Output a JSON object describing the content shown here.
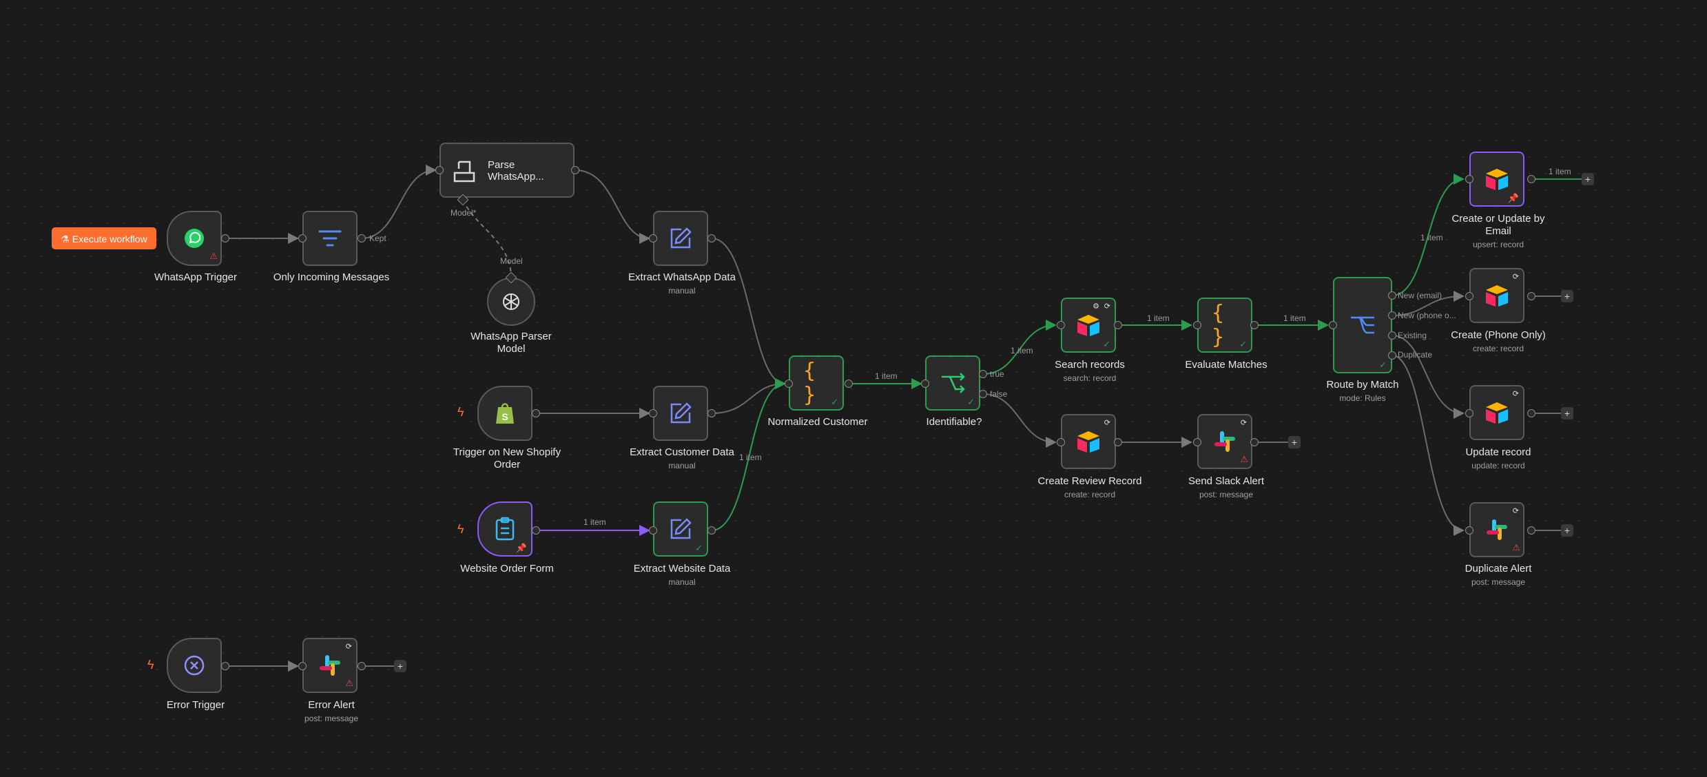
{
  "toolbar": {
    "execute_label": "Execute workflow"
  },
  "nodes": {
    "whatsapp_trigger": {
      "name": "WhatsApp Trigger"
    },
    "only_incoming": {
      "name": "Only Incoming Messages",
      "output_label": "Kept"
    },
    "parse_whatsapp": {
      "name_line1": "Parse",
      "name_line2": "WhatsApp...",
      "model_port": "Model*"
    },
    "parser_model": {
      "name_line1": "WhatsApp Parser",
      "name_line2": "Model",
      "port_label": "Model"
    },
    "extract_whatsapp": {
      "name": "Extract WhatsApp Data",
      "sub": "manual"
    },
    "shopify_trigger": {
      "name_line1": "Trigger on New Shopify",
      "name_line2": "Order"
    },
    "extract_customer": {
      "name": "Extract Customer Data",
      "sub": "manual"
    },
    "website_form": {
      "name": "Website Order Form"
    },
    "extract_website": {
      "name": "Extract Website Data",
      "sub": "manual"
    },
    "normalized_customer": {
      "name": "Normalized Customer"
    },
    "identifiable": {
      "name": "Identifiable?",
      "out_true": "true",
      "out_false": "false"
    },
    "search_records": {
      "name": "Search records",
      "sub": "search: record"
    },
    "evaluate_matches": {
      "name": "Evaluate Matches"
    },
    "create_review": {
      "name": "Create Review Record",
      "sub": "create: record"
    },
    "send_slack": {
      "name": "Send Slack Alert",
      "sub": "post: message"
    },
    "route_by_match": {
      "name": "Route by Match",
      "sub": "mode: Rules",
      "outputs": [
        "New (email)",
        "New (phone o...",
        "Existing",
        "Duplicate"
      ]
    },
    "create_update_email": {
      "name_line1": "Create or Update by",
      "name_line2": "Email",
      "sub": "upsert: record"
    },
    "create_phone": {
      "name": "Create (Phone Only)",
      "sub": "create: record"
    },
    "update_record": {
      "name": "Update record",
      "sub": "update: record"
    },
    "duplicate_alert": {
      "name": "Duplicate Alert",
      "sub": "post: message"
    },
    "error_trigger": {
      "name": "Error Trigger"
    },
    "error_alert": {
      "name": "Error Alert",
      "sub": "post: message"
    }
  },
  "edge_labels": {
    "website_to_extract": "1 item",
    "extract_website_to_norm": "1 item",
    "norm_to_ident": "1 item",
    "ident_to_search": "1 item",
    "search_to_eval": "1 item",
    "eval_to_route": "1 item",
    "route_to_email": "1 item",
    "email_out": "1 item"
  },
  "plus_label": "+",
  "colors": {
    "success": "#2a9d4e",
    "pinned": "#8b5cf6",
    "accent": "#ff6d2e",
    "edge": "#6b6b6b"
  }
}
